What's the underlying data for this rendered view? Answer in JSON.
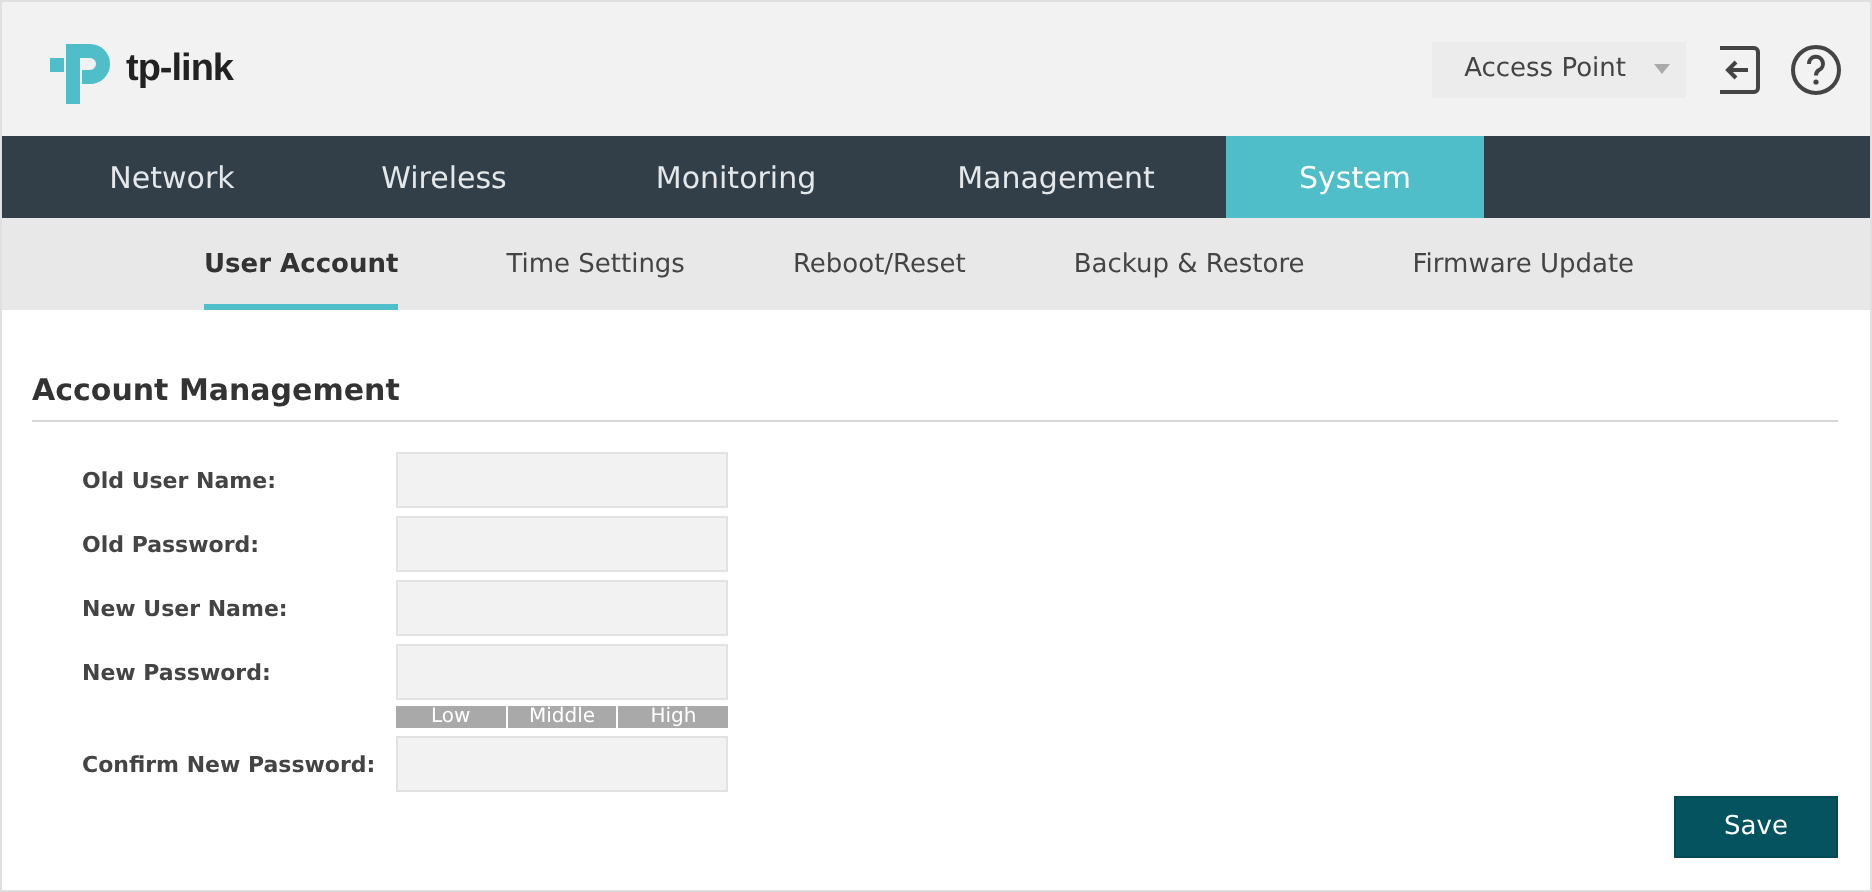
{
  "header": {
    "brand": "tp-link",
    "mode": "Access Point"
  },
  "nav": [
    {
      "label": "Network",
      "selected": false
    },
    {
      "label": "Wireless",
      "selected": false
    },
    {
      "label": "Monitoring",
      "selected": false
    },
    {
      "label": "Management",
      "selected": false
    },
    {
      "label": "System",
      "selected": true
    }
  ],
  "subnav": [
    {
      "label": "User Account",
      "selected": true
    },
    {
      "label": "Time Settings",
      "selected": false
    },
    {
      "label": "Reboot/Reset",
      "selected": false
    },
    {
      "label": "Backup & Restore",
      "selected": false
    },
    {
      "label": "Firmware Update",
      "selected": false
    }
  ],
  "section": {
    "title": "Account Management"
  },
  "fields": [
    {
      "label": "Old User Name:"
    },
    {
      "label": "Old Password:"
    },
    {
      "label": "New User Name:"
    },
    {
      "label": "New Password:",
      "strength": [
        "Low",
        "Middle",
        "High"
      ]
    },
    {
      "label": "Confirm New Password:"
    }
  ],
  "buttons": [
    "Save"
  ]
}
